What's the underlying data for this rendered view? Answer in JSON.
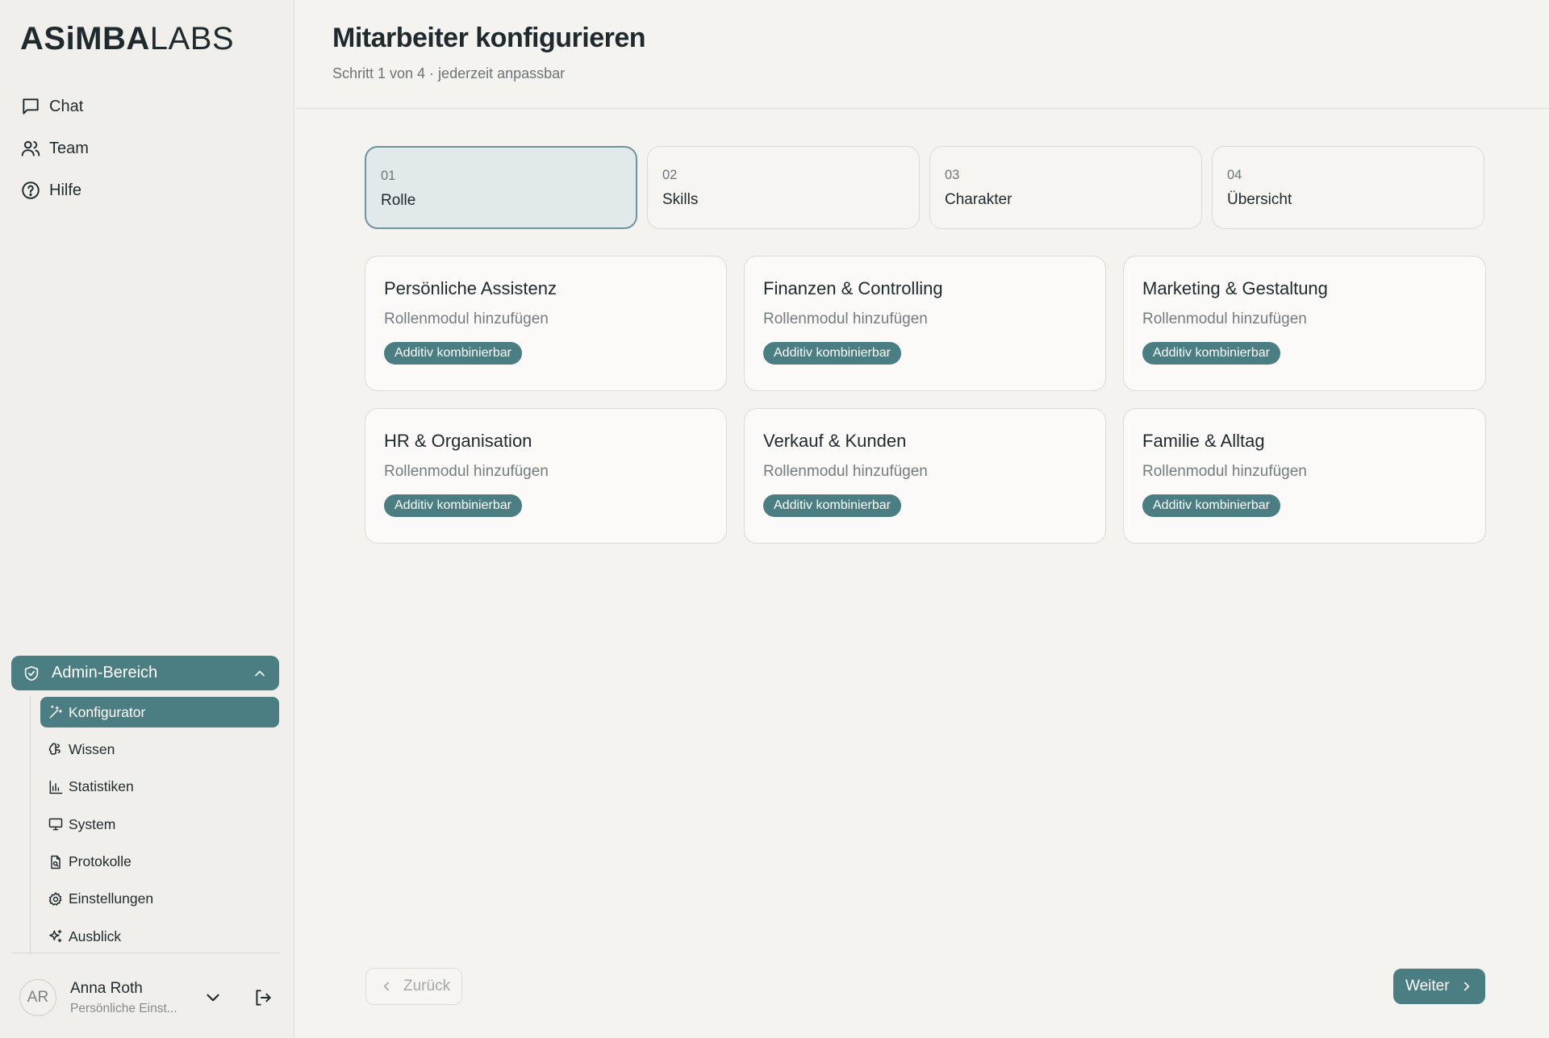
{
  "brand": {
    "bold": "ASiMBA",
    "light": "LABS"
  },
  "sidebar": {
    "nav": [
      {
        "label": "Chat",
        "icon": "chat-icon"
      },
      {
        "label": "Team",
        "icon": "users-icon"
      },
      {
        "label": "Hilfe",
        "icon": "help-icon"
      }
    ],
    "admin": {
      "label": "Admin-Bereich",
      "icon": "shield-icon",
      "expanded": true,
      "items": [
        {
          "label": "Konfigurator",
          "icon": "wand-icon",
          "active": true
        },
        {
          "label": "Wissen",
          "icon": "brain-icon"
        },
        {
          "label": "Statistiken",
          "icon": "bar-chart-icon"
        },
        {
          "label": "System",
          "icon": "monitor-icon"
        },
        {
          "label": "Protokolle",
          "icon": "file-search-icon"
        },
        {
          "label": "Einstellungen",
          "icon": "gear-icon"
        },
        {
          "label": "Ausblick",
          "icon": "sparkles-icon"
        }
      ]
    },
    "user": {
      "initials": "AR",
      "name": "Anna Roth",
      "subtitle": "Persönliche Einst..."
    }
  },
  "header": {
    "title": "Mitarbeiter konfigurieren",
    "subtitle": "Schritt 1 von 4 · jederzeit anpassbar"
  },
  "steps": [
    {
      "number": "01",
      "label": "Rolle",
      "active": true
    },
    {
      "number": "02",
      "label": "Skills"
    },
    {
      "number": "03",
      "label": "Charakter"
    },
    {
      "number": "04",
      "label": "Übersicht"
    }
  ],
  "cards": [
    {
      "title": "Persönliche Assistenz",
      "subtitle": "Rollenmodul hinzufügen",
      "badge": "Additiv kombinierbar"
    },
    {
      "title": "Finanzen & Controlling",
      "subtitle": "Rollenmodul hinzufügen",
      "badge": "Additiv kombinierbar"
    },
    {
      "title": "Marketing & Gestaltung",
      "subtitle": "Rollenmodul hinzufügen",
      "badge": "Additiv kombinierbar"
    },
    {
      "title": "HR & Organisation",
      "subtitle": "Rollenmodul hinzufügen",
      "badge": "Additiv kombinierbar"
    },
    {
      "title": "Verkauf & Kunden",
      "subtitle": "Rollenmodul hinzufügen",
      "badge": "Additiv kombinierbar"
    },
    {
      "title": "Familie & Alltag",
      "subtitle": "Rollenmodul hinzufügen",
      "badge": "Additiv kombinierbar"
    }
  ],
  "footer": {
    "back": "Zurück",
    "next": "Weiter"
  },
  "colors": {
    "accent": "#4a7e82",
    "background": "#f4f3ef",
    "active_step_bg": "#e1e9ea",
    "text": "#1f2a2e"
  }
}
